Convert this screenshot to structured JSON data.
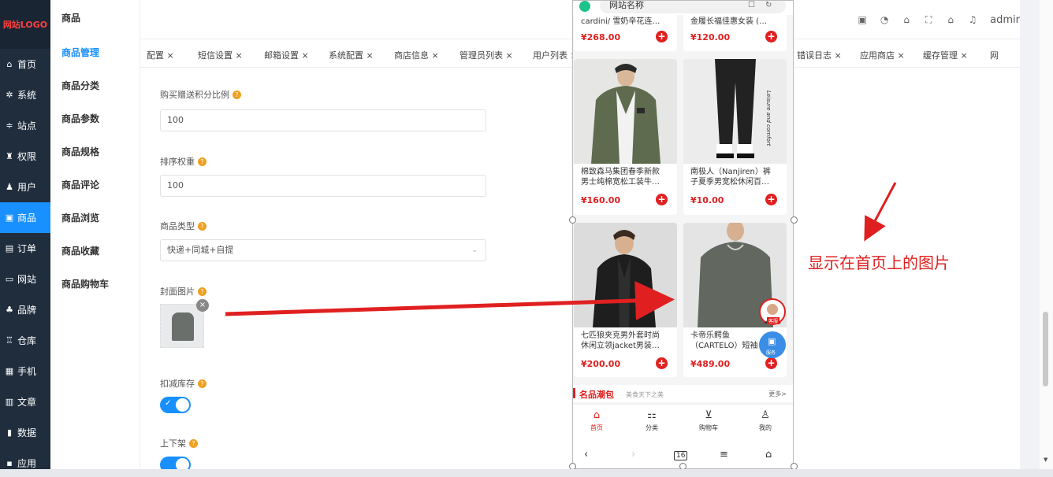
{
  "sidebar": {
    "logo": "网站LOGO",
    "items": [
      {
        "icon": "home-icon",
        "glyph": "⌂",
        "label": "首页"
      },
      {
        "icon": "gear-icon",
        "glyph": "✲",
        "label": "系统"
      },
      {
        "icon": "sliders-icon",
        "glyph": "≑",
        "label": "站点"
      },
      {
        "icon": "user-key-icon",
        "glyph": "♜",
        "label": "权限"
      },
      {
        "icon": "user-icon",
        "glyph": "♟",
        "label": "用户"
      },
      {
        "icon": "goods-icon",
        "glyph": "▣",
        "label": "商品"
      },
      {
        "icon": "order-icon",
        "glyph": "▤",
        "label": "订单"
      },
      {
        "icon": "website-icon",
        "glyph": "▭",
        "label": "网站"
      },
      {
        "icon": "brand-icon",
        "glyph": "♣",
        "label": "品牌"
      },
      {
        "icon": "warehouse-icon",
        "glyph": "♖",
        "label": "仓库"
      },
      {
        "icon": "mobile-icon",
        "glyph": "▦",
        "label": "手机"
      },
      {
        "icon": "article-icon",
        "glyph": "▥",
        "label": "文章"
      },
      {
        "icon": "chart-icon",
        "glyph": "▮",
        "label": "数据"
      },
      {
        "icon": "apps-icon",
        "glyph": "▪",
        "label": "应用"
      }
    ]
  },
  "subnav": {
    "title": "商品",
    "items": [
      "商品管理",
      "商品分类",
      "商品参数",
      "商品规格",
      "商品评论",
      "商品浏览",
      "商品收藏",
      "商品购物车"
    ]
  },
  "header": {
    "admin": "admir"
  },
  "tabs": {
    "left": [
      "配置 ×",
      "短信设置 ×",
      "邮箱设置 ×",
      "系统配置 ×",
      "商店信息 ×",
      "管理员列表 ×",
      "用户列表 ×"
    ],
    "right": [
      "错误日志 ×",
      "应用商店 ×",
      "缓存管理 ×",
      "网"
    ]
  },
  "form": {
    "points_label": "购买赠送积分比例",
    "points_value": "100",
    "sort_label": "排序权重",
    "sort_value": "100",
    "type_label": "商品类型",
    "type_value": "快递+同城+自提",
    "cover_label": "封面图片",
    "stock_label": "扣减库存",
    "shelf_label": "上下架"
  },
  "phone": {
    "site_name": "网站名称",
    "top_cards": [
      {
        "title": "cardini/ 雪奶辛花连…",
        "price": "¥268.00"
      },
      {
        "title": "金履长福佳惠女装 (…",
        "price": "¥120.00"
      }
    ],
    "cards": [
      {
        "title1": "棉致森马集团春季新款",
        "title2": "男士纯棉宽松工装牛…",
        "price": "¥160.00"
      },
      {
        "title1": "南极人（Nanjiren）裤",
        "title2": "子夏季男宽松休闲百…",
        "price": "¥10.00"
      },
      {
        "title1": "七匹狼夹克男外套时尚",
        "title2": "休闲立领jacket男装…",
        "price": "¥200.00"
      },
      {
        "title1": "卡帝乐鳄鱼",
        "title2": "（CARTELO）短袖",
        "price": "¥489.00"
      }
    ],
    "pants_text": "Leisure and comfort",
    "section_title": "名品潮包",
    "section_sub": "美食天下之美",
    "section_more": "更多>",
    "service_label": "客服",
    "service_label2": "服务",
    "tabbar": [
      "首页",
      "分类",
      "购物车",
      "我的"
    ],
    "nav_page": "16"
  },
  "annotation": "显示在首页上的图片",
  "colors": {
    "accent": "#1890ff",
    "sidebar_bg": "#1f2d3d",
    "red": "#e02020"
  }
}
